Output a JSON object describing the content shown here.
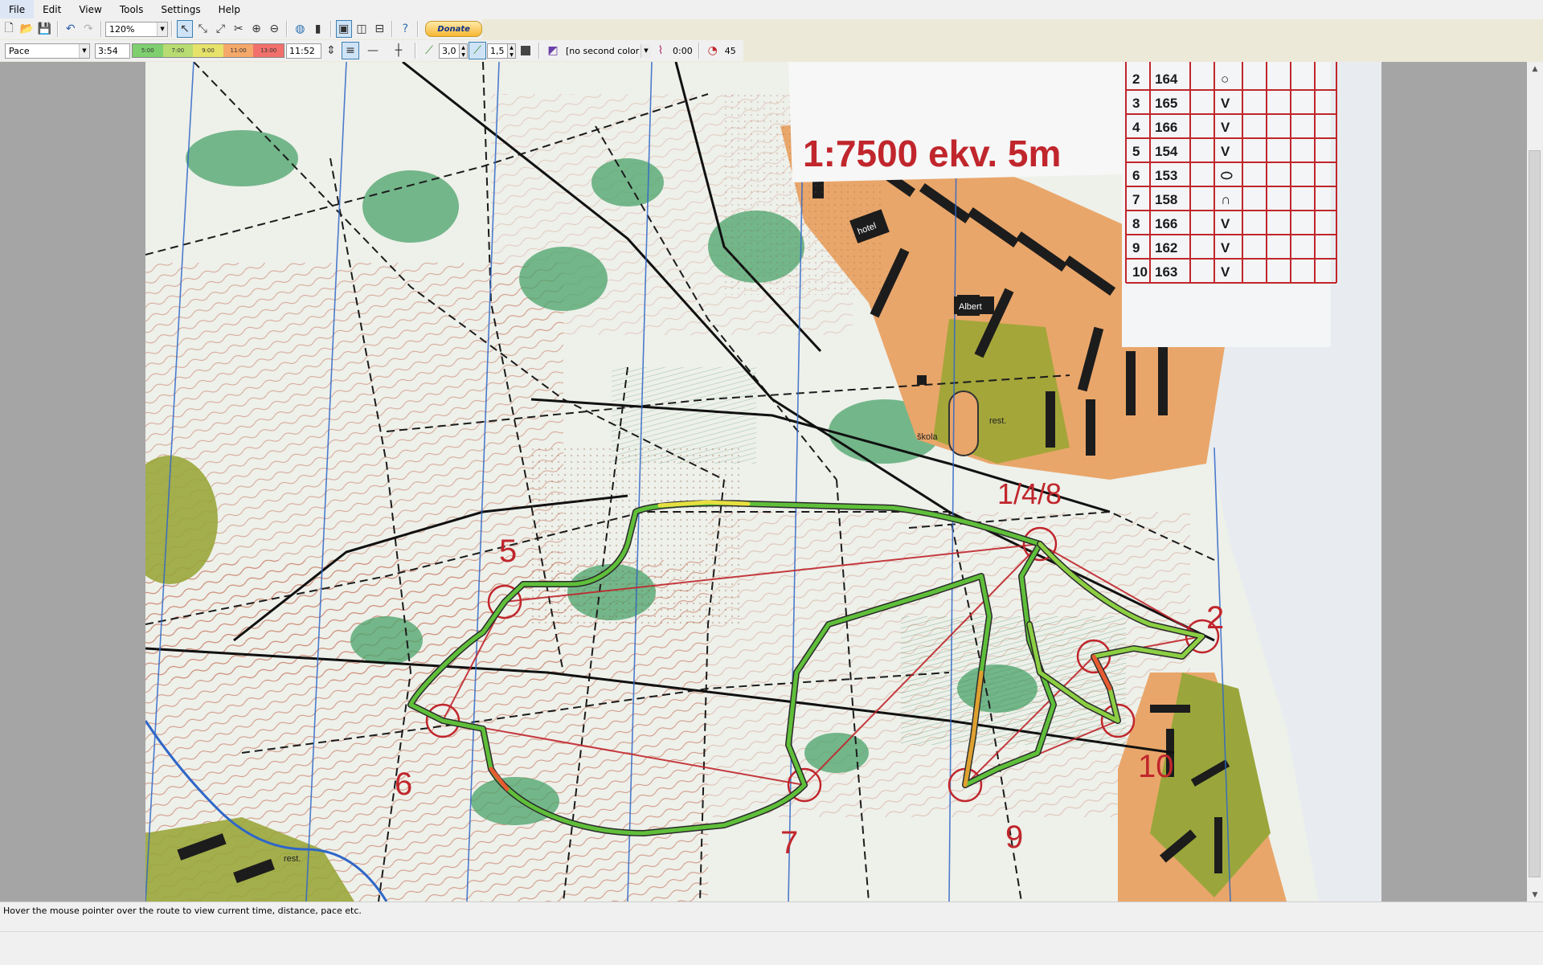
{
  "menu": [
    "File",
    "Edit",
    "View",
    "Tools",
    "Settings",
    "Help"
  ],
  "toolbar1": {
    "zoom": "120%",
    "donate_label": "Donate"
  },
  "toolbar2": {
    "color_coding": "Pace",
    "range_min": "3:54",
    "range_max": "11:52",
    "scale_ticks": [
      "5:00",
      "7:00",
      "9:00",
      "11:00",
      "13:00"
    ],
    "line_width": "3,0",
    "mask_width": "1,5",
    "second_color": "[no second color",
    "smoothing": "0:00",
    "lap_value": "45"
  },
  "map": {
    "scale_text": "1:7500  ekv. 5m",
    "controls": [
      "1/4/8",
      "2",
      "5",
      "6",
      "7",
      "9",
      "10"
    ],
    "table": [
      {
        "n": "2",
        "code": "164",
        "sym": "○"
      },
      {
        "n": "3",
        "code": "165",
        "sym": "V"
      },
      {
        "n": "4",
        "code": "166",
        "sym": "V"
      },
      {
        "n": "5",
        "code": "154",
        "sym": "V"
      },
      {
        "n": "6",
        "code": "153",
        "sym": "⬭"
      },
      {
        "n": "7",
        "code": "158",
        "sym": "∩"
      },
      {
        "n": "8",
        "code": "166",
        "sym": "V"
      },
      {
        "n": "9",
        "code": "162",
        "sym": "V"
      },
      {
        "n": "10",
        "code": "163",
        "sym": "V"
      }
    ],
    "place_labels": [
      "hotel",
      "Albert",
      "škola",
      "rest.",
      "rest."
    ]
  },
  "status": {
    "text": "Hover the mouse pointer over the route to view current time, distance, pace etc."
  },
  "colors": {
    "route_green": "#5fbf3a",
    "route_yellow": "#e8e040",
    "course_red": "#c0262c",
    "urban_orange": "#e9a66a",
    "forest_green": "#4aa36a"
  }
}
